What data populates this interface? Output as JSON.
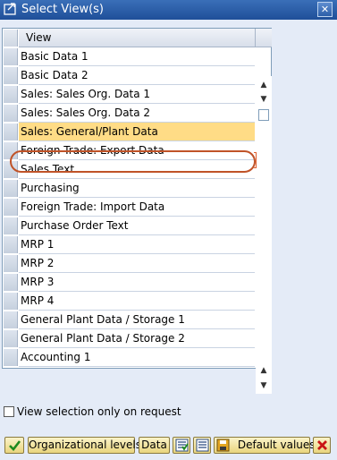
{
  "window": {
    "title": "Select View(s)",
    "close_icon": "close-icon"
  },
  "table": {
    "header": "View",
    "rows": [
      {
        "label": "Basic Data 1"
      },
      {
        "label": "Basic Data 2"
      },
      {
        "label": "Sales: Sales Org. Data 1"
      },
      {
        "label": "Sales: Sales Org. Data 2"
      },
      {
        "label": "Sales: General/Plant Data",
        "highlighted": true
      },
      {
        "label": "Foreign Trade: Export Data"
      },
      {
        "label": "Sales Text"
      },
      {
        "label": "Purchasing"
      },
      {
        "label": "Foreign Trade: Import Data"
      },
      {
        "label": "Purchase Order Text"
      },
      {
        "label": "MRP 1"
      },
      {
        "label": "MRP 2"
      },
      {
        "label": "MRP 3"
      },
      {
        "label": "MRP 4"
      },
      {
        "label": "General Plant Data / Storage 1"
      },
      {
        "label": "General Plant Data / Storage 2"
      },
      {
        "label": "Accounting 1"
      }
    ]
  },
  "option": {
    "label": "View selection only on request",
    "checked": false
  },
  "toolbar": {
    "org_levels": "Organizational levels",
    "data": "Data",
    "default_values": "Default values"
  },
  "colors": {
    "highlight": "#ffdc86",
    "annotation": "#c05328"
  }
}
